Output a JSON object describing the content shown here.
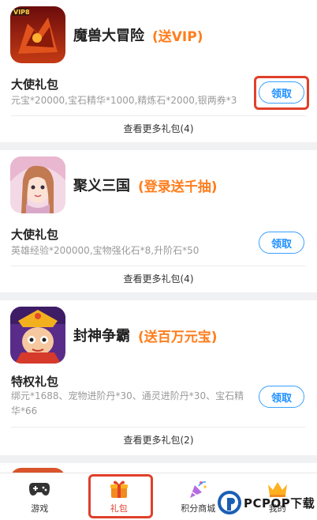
{
  "games": [
    {
      "name": "魔兽大冒险",
      "promo": "(送VIP)",
      "icon": "warcraft-adventure-game-icon",
      "gift_title": "大使礼包",
      "gift_desc": "元宝*20000,宝石精华*1000,精炼石*2000,银两券*3",
      "claim_label": "领取",
      "more_label": "查看更多礼包(4)"
    },
    {
      "name": "聚义三国",
      "promo": "(登录送千抽)",
      "icon": "three-kingdoms-game-icon",
      "gift_title": "大使礼包",
      "gift_desc": "英雄经验*200000,宝物强化石*8,升阶石*50",
      "claim_label": "领取",
      "more_label": "查看更多礼包(4)"
    },
    {
      "name": "封神争霸",
      "promo": "(送百万元宝)",
      "icon": "fengshen-game-icon",
      "gift_title": "特权礼包",
      "gift_desc": "绑元*1688、宠物进阶丹*30、通灵进阶丹*30、宝石精华*66",
      "claim_label": "领取",
      "more_label": "查看更多礼包(2)"
    }
  ],
  "tabbar": {
    "tabs": [
      {
        "label": "游戏",
        "icon": "gamepad-icon"
      },
      {
        "label": "礼包",
        "icon": "gift-icon",
        "active": true
      },
      {
        "label": "积分商城",
        "icon": "party-popper-icon"
      },
      {
        "label": "我的",
        "icon": "crown-icon"
      }
    ]
  },
  "watermark": {
    "text": "PCPOP下载"
  },
  "colors": {
    "accent": "#ff7d1c",
    "button": "#1e90ff",
    "highlight": "#e0402a"
  }
}
